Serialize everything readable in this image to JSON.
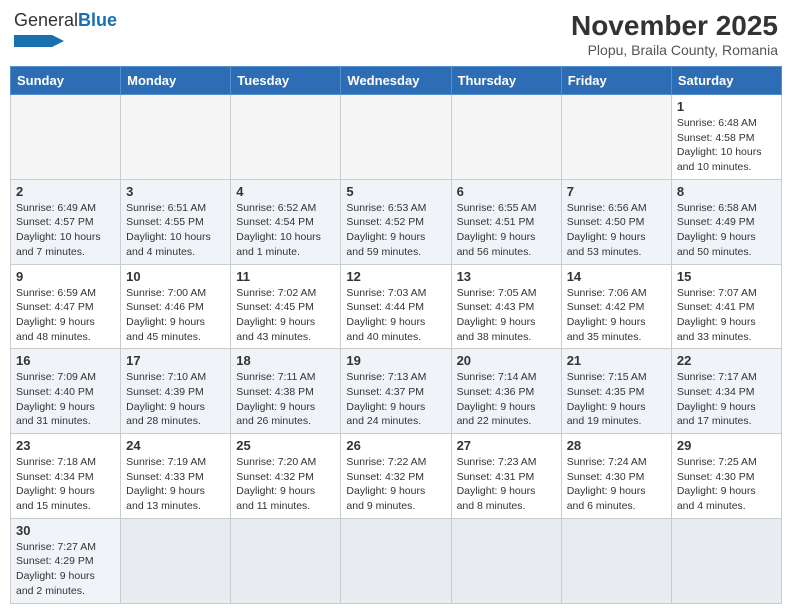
{
  "header": {
    "logo_general": "General",
    "logo_blue": "Blue",
    "month_title": "November 2025",
    "subtitle": "Plopu, Braila County, Romania"
  },
  "weekdays": [
    "Sunday",
    "Monday",
    "Tuesday",
    "Wednesday",
    "Thursday",
    "Friday",
    "Saturday"
  ],
  "rows": [
    [
      {
        "day": "",
        "info": ""
      },
      {
        "day": "",
        "info": ""
      },
      {
        "day": "",
        "info": ""
      },
      {
        "day": "",
        "info": ""
      },
      {
        "day": "",
        "info": ""
      },
      {
        "day": "",
        "info": ""
      },
      {
        "day": "1",
        "info": "Sunrise: 6:48 AM\nSunset: 4:58 PM\nDaylight: 10 hours\nand 10 minutes."
      }
    ],
    [
      {
        "day": "2",
        "info": "Sunrise: 6:49 AM\nSunset: 4:57 PM\nDaylight: 10 hours\nand 7 minutes."
      },
      {
        "day": "3",
        "info": "Sunrise: 6:51 AM\nSunset: 4:55 PM\nDaylight: 10 hours\nand 4 minutes."
      },
      {
        "day": "4",
        "info": "Sunrise: 6:52 AM\nSunset: 4:54 PM\nDaylight: 10 hours\nand 1 minute."
      },
      {
        "day": "5",
        "info": "Sunrise: 6:53 AM\nSunset: 4:52 PM\nDaylight: 9 hours\nand 59 minutes."
      },
      {
        "day": "6",
        "info": "Sunrise: 6:55 AM\nSunset: 4:51 PM\nDaylight: 9 hours\nand 56 minutes."
      },
      {
        "day": "7",
        "info": "Sunrise: 6:56 AM\nSunset: 4:50 PM\nDaylight: 9 hours\nand 53 minutes."
      },
      {
        "day": "8",
        "info": "Sunrise: 6:58 AM\nSunset: 4:49 PM\nDaylight: 9 hours\nand 50 minutes."
      }
    ],
    [
      {
        "day": "9",
        "info": "Sunrise: 6:59 AM\nSunset: 4:47 PM\nDaylight: 9 hours\nand 48 minutes."
      },
      {
        "day": "10",
        "info": "Sunrise: 7:00 AM\nSunset: 4:46 PM\nDaylight: 9 hours\nand 45 minutes."
      },
      {
        "day": "11",
        "info": "Sunrise: 7:02 AM\nSunset: 4:45 PM\nDaylight: 9 hours\nand 43 minutes."
      },
      {
        "day": "12",
        "info": "Sunrise: 7:03 AM\nSunset: 4:44 PM\nDaylight: 9 hours\nand 40 minutes."
      },
      {
        "day": "13",
        "info": "Sunrise: 7:05 AM\nSunset: 4:43 PM\nDaylight: 9 hours\nand 38 minutes."
      },
      {
        "day": "14",
        "info": "Sunrise: 7:06 AM\nSunset: 4:42 PM\nDaylight: 9 hours\nand 35 minutes."
      },
      {
        "day": "15",
        "info": "Sunrise: 7:07 AM\nSunset: 4:41 PM\nDaylight: 9 hours\nand 33 minutes."
      }
    ],
    [
      {
        "day": "16",
        "info": "Sunrise: 7:09 AM\nSunset: 4:40 PM\nDaylight: 9 hours\nand 31 minutes."
      },
      {
        "day": "17",
        "info": "Sunrise: 7:10 AM\nSunset: 4:39 PM\nDaylight: 9 hours\nand 28 minutes."
      },
      {
        "day": "18",
        "info": "Sunrise: 7:11 AM\nSunset: 4:38 PM\nDaylight: 9 hours\nand 26 minutes."
      },
      {
        "day": "19",
        "info": "Sunrise: 7:13 AM\nSunset: 4:37 PM\nDaylight: 9 hours\nand 24 minutes."
      },
      {
        "day": "20",
        "info": "Sunrise: 7:14 AM\nSunset: 4:36 PM\nDaylight: 9 hours\nand 22 minutes."
      },
      {
        "day": "21",
        "info": "Sunrise: 7:15 AM\nSunset: 4:35 PM\nDaylight: 9 hours\nand 19 minutes."
      },
      {
        "day": "22",
        "info": "Sunrise: 7:17 AM\nSunset: 4:34 PM\nDaylight: 9 hours\nand 17 minutes."
      }
    ],
    [
      {
        "day": "23",
        "info": "Sunrise: 7:18 AM\nSunset: 4:34 PM\nDaylight: 9 hours\nand 15 minutes."
      },
      {
        "day": "24",
        "info": "Sunrise: 7:19 AM\nSunset: 4:33 PM\nDaylight: 9 hours\nand 13 minutes."
      },
      {
        "day": "25",
        "info": "Sunrise: 7:20 AM\nSunset: 4:32 PM\nDaylight: 9 hours\nand 11 minutes."
      },
      {
        "day": "26",
        "info": "Sunrise: 7:22 AM\nSunset: 4:32 PM\nDaylight: 9 hours\nand 9 minutes."
      },
      {
        "day": "27",
        "info": "Sunrise: 7:23 AM\nSunset: 4:31 PM\nDaylight: 9 hours\nand 8 minutes."
      },
      {
        "day": "28",
        "info": "Sunrise: 7:24 AM\nSunset: 4:30 PM\nDaylight: 9 hours\nand 6 minutes."
      },
      {
        "day": "29",
        "info": "Sunrise: 7:25 AM\nSunset: 4:30 PM\nDaylight: 9 hours\nand 4 minutes."
      }
    ],
    [
      {
        "day": "30",
        "info": "Sunrise: 7:27 AM\nSunset: 4:29 PM\nDaylight: 9 hours\nand 2 minutes."
      },
      {
        "day": "",
        "info": ""
      },
      {
        "day": "",
        "info": ""
      },
      {
        "day": "",
        "info": ""
      },
      {
        "day": "",
        "info": ""
      },
      {
        "day": "",
        "info": ""
      },
      {
        "day": "",
        "info": ""
      }
    ]
  ]
}
